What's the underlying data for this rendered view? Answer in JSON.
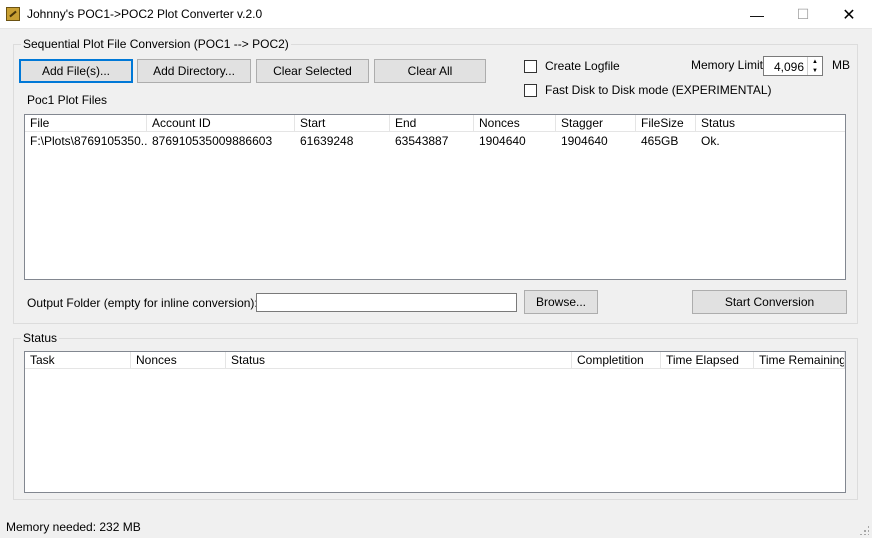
{
  "window": {
    "title": "Johnny's POC1->POC2 Plot Converter v.2.0",
    "minimize": "—",
    "maximize": "☐",
    "close": "✕"
  },
  "conversion": {
    "group_label": "Sequential Plot File Conversion (POC1 --> POC2)",
    "buttons": {
      "add_files": "Add File(s)...",
      "add_directory": "Add Directory...",
      "clear_selected": "Clear Selected",
      "clear_all": "Clear All"
    },
    "create_logfile": "Create Logfile",
    "fast_disk": "Fast Disk to Disk mode (EXPERIMENTAL)",
    "memory_limit_label": "Memory Limit",
    "memory_limit_value": "4,096",
    "memory_unit": "MB",
    "list_label": "Poc1 Plot Files",
    "columns": [
      "File",
      "Account ID",
      "Start",
      "End",
      "Nonces",
      "Stagger",
      "FileSize",
      "Status"
    ],
    "rows": [
      [
        "F:\\Plots\\8769105350...",
        "876910535009886603",
        "61639248",
        "63543887",
        "1904640",
        "1904640",
        "465GB",
        "Ok."
      ]
    ],
    "output_folder_label": "Output Folder (empty for inline conversion):",
    "output_folder_value": "",
    "browse": "Browse...",
    "start": "Start Conversion"
  },
  "status": {
    "group_label": "Status",
    "columns": [
      "Task",
      "Nonces",
      "Status",
      "Completition",
      "Time Elapsed",
      "Time Remaining"
    ]
  },
  "statusbar": {
    "text": "Memory needed: 232 MB"
  }
}
